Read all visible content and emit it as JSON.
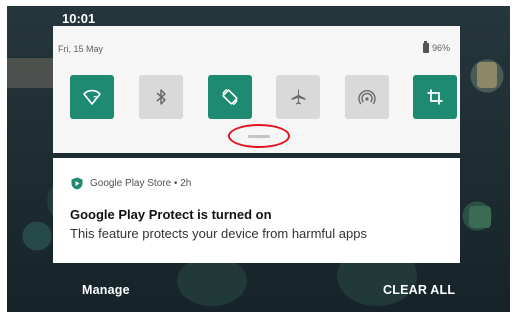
{
  "status_bar": {
    "time": "10:01"
  },
  "quick_settings": {
    "date": "Fri, 15 May",
    "battery": "96%",
    "tiles": [
      {
        "icon": "wifi-question-icon",
        "state": "on"
      },
      {
        "icon": "bluetooth-icon",
        "state": "off"
      },
      {
        "icon": "auto-rotate-icon",
        "state": "on"
      },
      {
        "icon": "airplane-icon",
        "state": "off"
      },
      {
        "icon": "hotspot-icon",
        "state": "off"
      },
      {
        "icon": "crop-icon",
        "state": "on"
      }
    ]
  },
  "notification": {
    "app": "Google Play Store • 2h",
    "title": "Google Play Protect is turned on",
    "body": "This feature protects your device from harmful apps"
  },
  "footer": {
    "manage": "Manage",
    "clear_all": "CLEAR ALL"
  },
  "colors": {
    "accent": "#1e8a72",
    "tile_off": "#d9d9d9",
    "annotation": "#e0141e"
  }
}
